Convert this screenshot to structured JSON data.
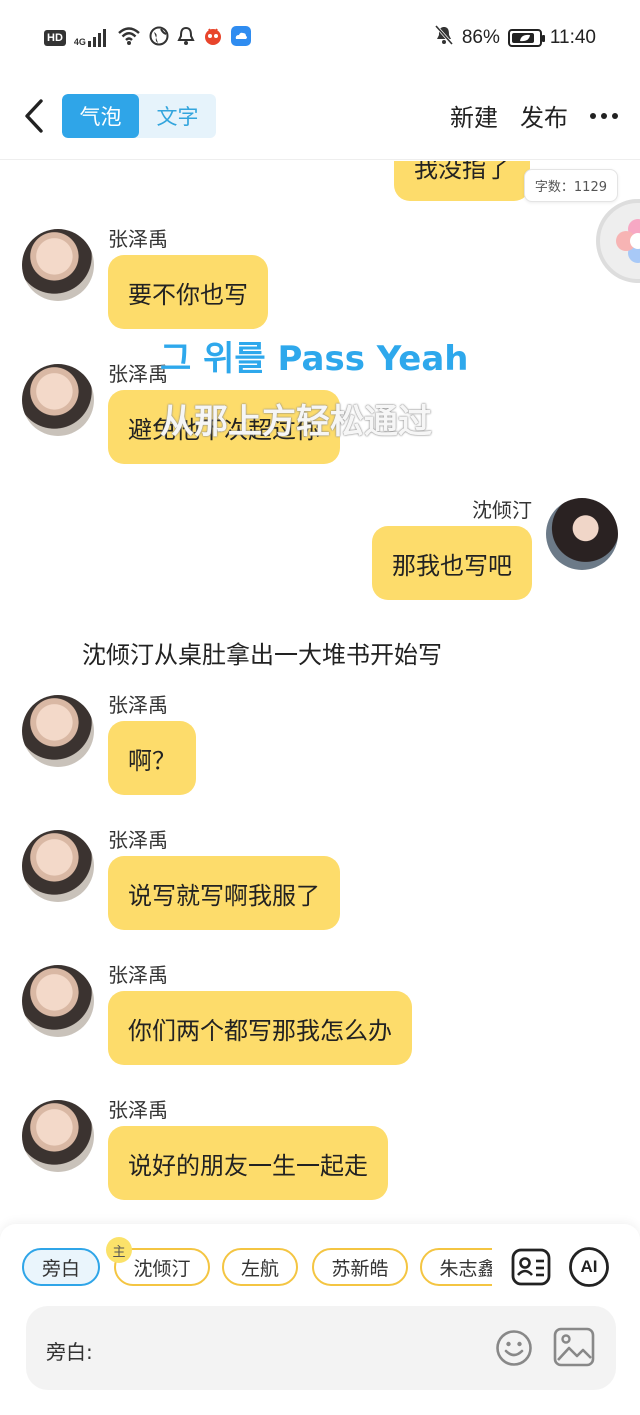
{
  "status_bar": {
    "hd": "HD",
    "network": "4G",
    "battery_percent": "86%",
    "battery_level": 0.86,
    "time": "11:40"
  },
  "nav": {
    "toggle": [
      "气泡",
      "文字"
    ],
    "active_toggle": 0,
    "new_label": "新建",
    "publish_label": "发布"
  },
  "word_count": "字数：1129",
  "overlay_text": {
    "line1": "그 위를 Pass Yeah",
    "line2": "从那上方轻松通过"
  },
  "messages": [
    {
      "side": "right",
      "name": "",
      "text": "我没指了",
      "partial": true
    },
    {
      "side": "left",
      "name": "张泽禹",
      "text": "要不你也写"
    },
    {
      "side": "left",
      "name": "张泽禹",
      "text": "避免他下次超过你"
    },
    {
      "side": "right",
      "name": "沈倾汀",
      "text": "那我也写吧"
    },
    {
      "side": "narration",
      "text": "沈倾汀从桌肚拿出一大堆书开始写"
    },
    {
      "side": "left",
      "name": "张泽禹",
      "text": "啊？"
    },
    {
      "side": "left",
      "name": "张泽禹",
      "text": "说写就写啊我服了"
    },
    {
      "side": "left",
      "name": "张泽禹",
      "text": "你们两个都写那我怎么办"
    },
    {
      "side": "left",
      "name": "张泽禹",
      "text": "说好的朋友一生一起走"
    }
  ],
  "characters": {
    "host_badge": "主",
    "chips": [
      "旁白",
      "沈倾汀",
      "左航",
      "苏新皓",
      "朱志鑫"
    ],
    "active_index": 0
  },
  "ai_label": "AI",
  "input": {
    "label": "旁白:",
    "value": "",
    "placeholder": ""
  },
  "colors": {
    "accent_blue": "#2fa5e8",
    "bubble_yellow": "#fddc6b",
    "chip_border": "#f4c542"
  }
}
